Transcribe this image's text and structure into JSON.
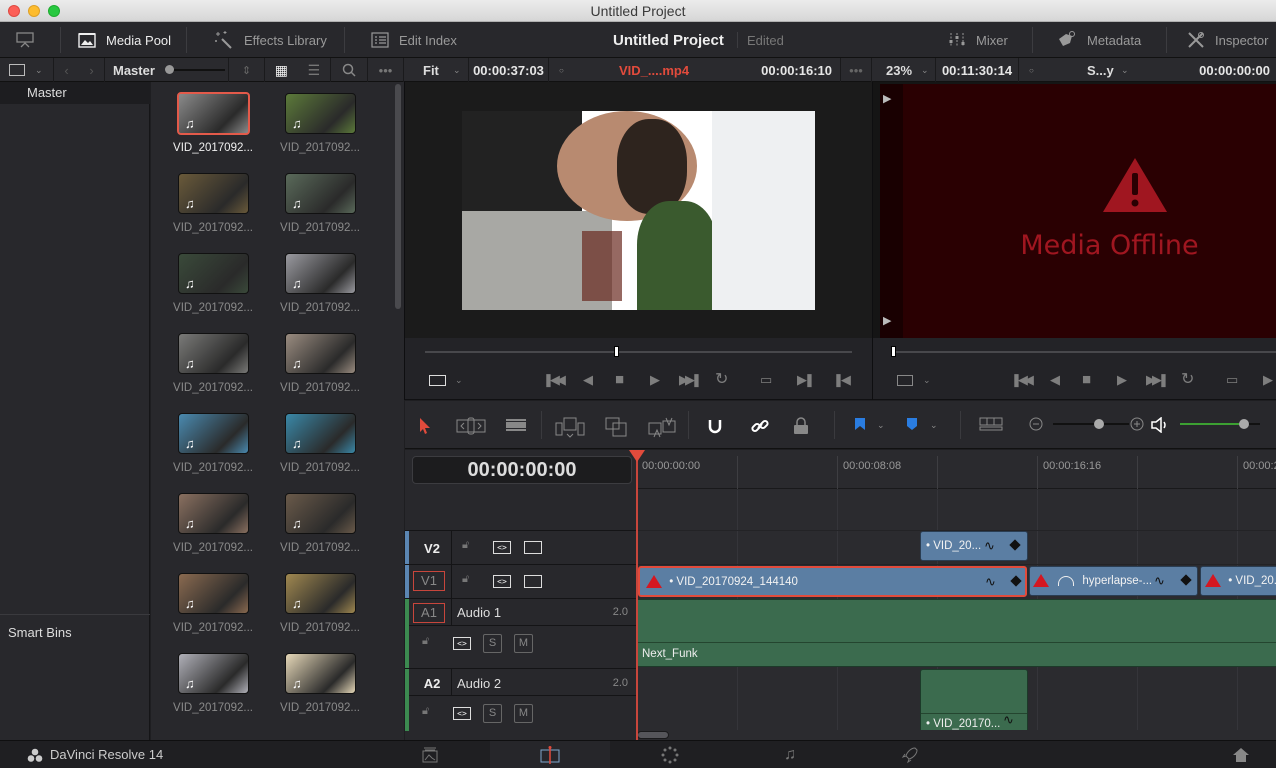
{
  "window": {
    "title": "Untitled Project"
  },
  "toolbar": {
    "media_pool": "Media Pool",
    "effects_library": "Effects Library",
    "edit_index": "Edit Index",
    "project_title": "Untitled Project",
    "project_status": "Edited",
    "mixer": "Mixer",
    "metadata": "Metadata",
    "inspector": "Inspector"
  },
  "subtoolbar": {
    "bin_name": "Master",
    "source_zoom": "Fit",
    "source_duration": "00:00:37:03",
    "source_clip": "VID_....mp4",
    "source_timecode": "00:00:16:10",
    "timeline_zoom": "23%",
    "timeline_duration": "00:11:30:14",
    "timeline_name": "S...y",
    "timeline_timecode": "00:00:00:00"
  },
  "bins": {
    "master": "Master",
    "smart_bins": "Smart Bins"
  },
  "media_pool": {
    "clips": [
      {
        "name": "VID_2017092...",
        "selected": true,
        "color": "#8a8a8a"
      },
      {
        "name": "VID_2017092...",
        "selected": false,
        "color": "#5c7a3a"
      },
      {
        "name": "VID_2017092...",
        "selected": false,
        "color": "#6a5a3a"
      },
      {
        "name": "VID_2017092...",
        "selected": false,
        "color": "#5a6a5a"
      },
      {
        "name": "VID_2017092...",
        "selected": false,
        "color": "#3a4a3a"
      },
      {
        "name": "VID_2017092...",
        "selected": false,
        "color": "#9a9aa0"
      },
      {
        "name": "VID_2017092...",
        "selected": false,
        "color": "#7a7a78"
      },
      {
        "name": "VID_2017092...",
        "selected": false,
        "color": "#9a8c80"
      },
      {
        "name": "VID_2017092...",
        "selected": false,
        "color": "#4a8ab0"
      },
      {
        "name": "VID_2017092...",
        "selected": false,
        "color": "#3a88a8"
      },
      {
        "name": "VID_2017092...",
        "selected": false,
        "color": "#8a7060"
      },
      {
        "name": "VID_2017092...",
        "selected": false,
        "color": "#6a5a4a"
      },
      {
        "name": "VID_2017092...",
        "selected": false,
        "color": "#8a6a50"
      },
      {
        "name": "VID_2017092...",
        "selected": false,
        "color": "#a08850"
      },
      {
        "name": "VID_2017092...",
        "selected": false,
        "color": "#b0b0b8"
      },
      {
        "name": "VID_2017092...",
        "selected": false,
        "color": "#e6d8b8"
      }
    ],
    "music_icon": "music-note-icon"
  },
  "timeline_viewer": {
    "message": "Media Offline"
  },
  "timeline": {
    "timecode": "00:00:00:00",
    "ruler": [
      "00:00:00:00",
      "00:00:08:08",
      "00:00:16:16",
      "00:00:2"
    ],
    "tracks": [
      {
        "id": "V2",
        "name": ""
      },
      {
        "id": "V1",
        "name": ""
      },
      {
        "id": "A1",
        "name": "Audio 1",
        "channels": "2.0"
      },
      {
        "id": "A2",
        "name": "Audio 2",
        "channels": "2.0"
      }
    ],
    "clips": {
      "v2_clip": "• VID_20...",
      "v1_main": "• VID_20170924_144140",
      "v1_hyperlapse": "hyperlapse-...",
      "v1_third": "• VID_20...",
      "a1_clip": "Next_Funk",
      "a2_clip": "• VID_20170..."
    },
    "solo_label": "S",
    "mute_label": "M",
    "zoom_level": 0.6,
    "volume_level": 0.8
  },
  "status": {
    "app_name": "DaVinci Resolve 14"
  },
  "colors": {
    "accent_red": "#e24b3c",
    "video_clip": "#5b7ea3",
    "audio_clip": "#3b6b4e",
    "offline_bg": "#2a0002",
    "offline_text": "#a01620"
  }
}
